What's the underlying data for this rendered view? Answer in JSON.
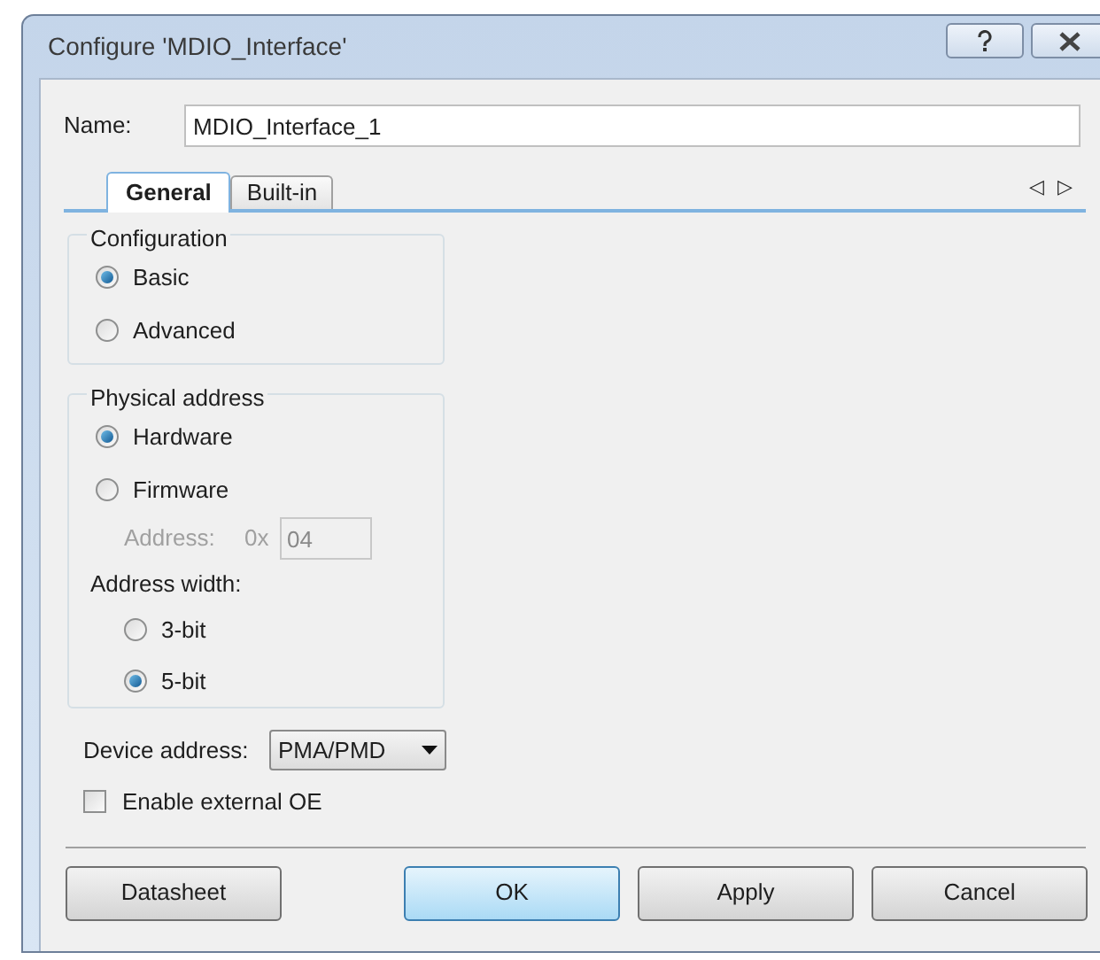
{
  "window": {
    "title": "Configure 'MDIO_Interface'",
    "buttons": [
      {
        "kind": "help"
      },
      {
        "kind": "close"
      }
    ]
  },
  "name": {
    "label": "Name:",
    "value": "MDIO_Interface_1"
  },
  "tabs": [
    {
      "label": "General",
      "selected": true
    },
    {
      "label": "Built-in",
      "selected": false
    }
  ],
  "tab_scroll": {
    "prev": "◁",
    "next": "▷"
  },
  "configuration": {
    "title": "Configuration",
    "options": [
      {
        "label": "Basic",
        "selected": true
      },
      {
        "label": "Advanced",
        "selected": false
      }
    ]
  },
  "physical_address": {
    "title": "Physical address",
    "options": [
      {
        "label": "Hardware",
        "selected": true
      },
      {
        "label": "Firmware",
        "selected": false
      }
    ],
    "address": {
      "label": "Address:",
      "prefix": "0x",
      "value": "04",
      "disabled": true
    },
    "address_width": {
      "label": "Address width:",
      "options": [
        {
          "label": "3-bit",
          "selected": false
        },
        {
          "label": "5-bit",
          "selected": true
        }
      ]
    }
  },
  "device_address": {
    "label": "Device address:",
    "value": "PMA/PMD"
  },
  "external_oe": {
    "label": "Enable external OE",
    "checked": false
  },
  "buttons": [
    {
      "label": "Datasheet",
      "default": false
    },
    {
      "label": "OK",
      "default": true
    },
    {
      "label": "Apply",
      "default": false
    },
    {
      "label": "Cancel",
      "default": false
    }
  ]
}
